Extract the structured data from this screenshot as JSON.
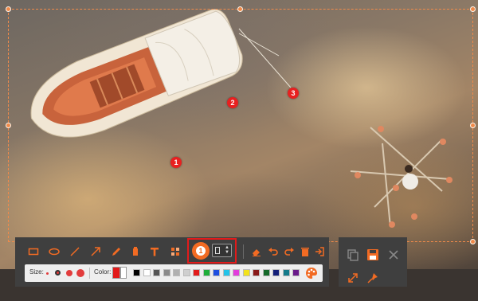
{
  "toolbar": {
    "tools": [
      {
        "name": "rectangle-tool",
        "icon": "rectangle-icon"
      },
      {
        "name": "ellipse-tool",
        "icon": "ellipse-icon"
      },
      {
        "name": "line-tool",
        "icon": "line-icon"
      },
      {
        "name": "arrow-tool",
        "icon": "arrow-icon"
      },
      {
        "name": "pencil-tool",
        "icon": "pencil-icon"
      },
      {
        "name": "highlighter-tool",
        "icon": "highlighter-icon"
      },
      {
        "name": "text-tool",
        "icon": "text-icon"
      },
      {
        "name": "mosaic-tool",
        "icon": "mosaic-icon"
      }
    ],
    "number_tool": {
      "label": "1",
      "selected_style": "box"
    },
    "actions": [
      {
        "name": "eraser-button",
        "icon": "eraser-icon"
      },
      {
        "name": "undo-button",
        "icon": "undo-icon"
      },
      {
        "name": "redo-button",
        "icon": "redo-icon"
      },
      {
        "name": "delete-button",
        "icon": "trash-icon"
      },
      {
        "name": "exit-button",
        "icon": "exit-icon"
      }
    ]
  },
  "options": {
    "size_label": "Size:",
    "color_label": "Color:",
    "sizes": [
      "small",
      "medium",
      "large",
      "x-large"
    ],
    "selected_size": "medium",
    "current_color": "#e21b1b",
    "palette": [
      "#000000",
      "#ffffff",
      "#555555",
      "#8a8a8a",
      "#b0b0b0",
      "#cfcfcf",
      "#e21b1b",
      "#1fae3a",
      "#1e4fe0",
      "#23c3e8",
      "#e23cdc",
      "#f2e21b",
      "#8a1a1a",
      "#156a2a",
      "#14207a",
      "#137a8a",
      "#6a1a8a"
    ],
    "palette_icon": "palette-icon"
  },
  "side_panel": {
    "icons": [
      "copy-icon",
      "save-icon",
      "close-icon",
      "fullscreen-icon",
      "pin-icon"
    ]
  },
  "markers": [
    "1",
    "2",
    "3"
  ]
}
